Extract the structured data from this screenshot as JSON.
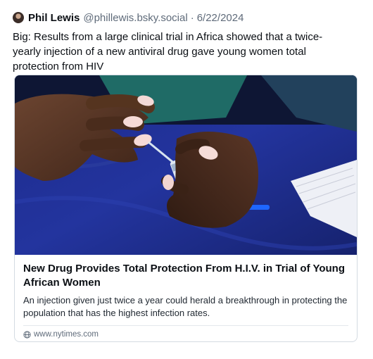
{
  "post": {
    "author": {
      "display_name": "Phil Lewis",
      "handle": "@phillewis.bsky.social",
      "separator": "·",
      "date": "6/22/2024"
    },
    "text": "Big: Results from a large clinical trial in Africa showed that a twice-yearly injection of a new antiviral drug gave young women total protection from HIV"
  },
  "link_card": {
    "image_icon": "photo-hands-holding-vial",
    "title": "New Drug Provides Total Protection From H.I.V. in Trial of Young African Women",
    "description": "An injection given just twice a year could herald a breakthrough in protecting the population that has the highest infection rates.",
    "domain_icon": "globe-icon",
    "domain": "www.nytimes.com"
  },
  "colors": {
    "text_primary": "#0b0f14",
    "text_secondary": "#5f6b7a",
    "card_border": "#d4dbe2"
  }
}
